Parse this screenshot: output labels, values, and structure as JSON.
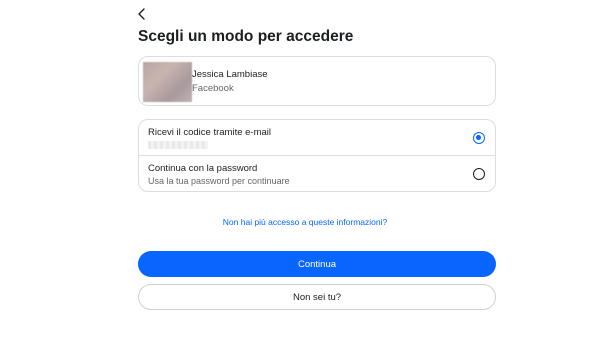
{
  "page": {
    "title": "Scegli un modo per accedere"
  },
  "header": {
    "back_icon": "chevron-left-icon"
  },
  "account": {
    "name": "Jessica Lambiase",
    "source": "Facebook"
  },
  "options": [
    {
      "title": "Ricevi il codice tramite e-mail",
      "subtitle": "",
      "selected": true
    },
    {
      "title": "Continua con la password",
      "subtitle": "Usa la tua password per continuare",
      "selected": false
    }
  ],
  "help_link": "Non hai più accesso a queste informazioni?",
  "buttons": {
    "continue_label": "Continua",
    "not_you_label": "Non sei tu?"
  },
  "colors": {
    "accent": "#0866ff",
    "border": "#dadde1",
    "text": "#1c1e21",
    "secondary_text": "#65676b"
  }
}
